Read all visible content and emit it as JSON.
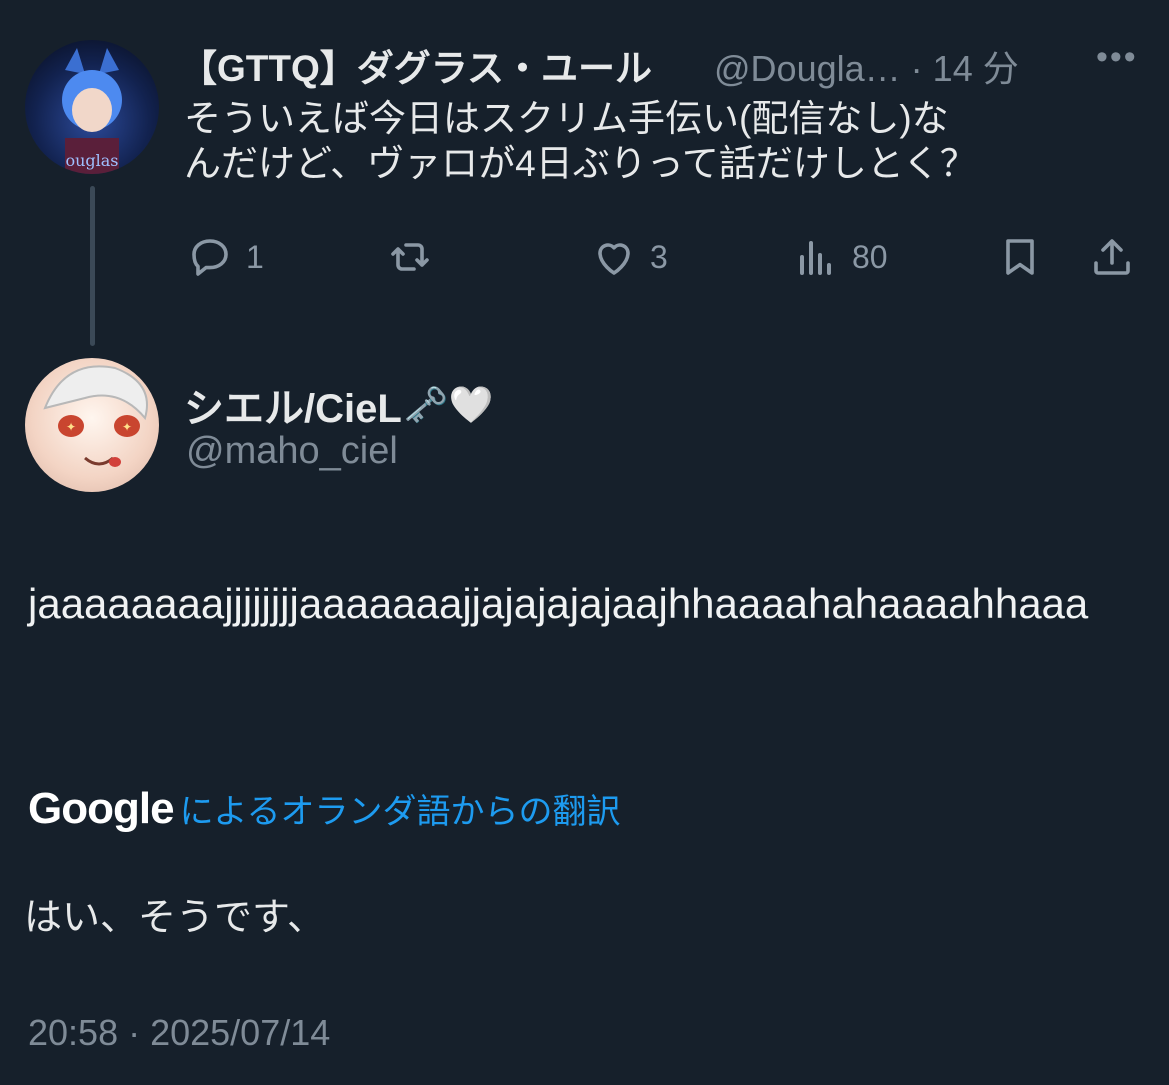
{
  "parent_tweet": {
    "author_name": "【GTTQ】ダグラス・ユール",
    "author_handle": "@Dougla…",
    "separator": "·",
    "time_ago": "14 分",
    "more": "•••",
    "text_line1": "そういえば今日はスクリム手伝い(配信なし)な",
    "text_line2": "んだけど、ヴァロが4日ぶりって話だけしとく？",
    "actions": {
      "reply_count": "1",
      "retweet_count": "",
      "like_count": "3",
      "view_count": "80"
    }
  },
  "reply_tweet": {
    "author_name": "シエル/CieL",
    "author_name_emoji": "🗝️🤍",
    "author_handle": "@maho_ciel",
    "text": "jaaaaaaaajjjjjjjjaaaaaaajjajajajajaajhhaaaahahaaaahhaaa",
    "translation": {
      "provider": "Google",
      "label": "によるオランダ語からの翻訳",
      "text": "はい、そうです、"
    },
    "timestamp": "20:58 · 2025/07/14"
  },
  "colors": {
    "background": "#16202b",
    "text": "#e7e9ea",
    "muted": "#7f8b97",
    "link": "#1d9bf0",
    "thread_line": "#3b4957"
  }
}
